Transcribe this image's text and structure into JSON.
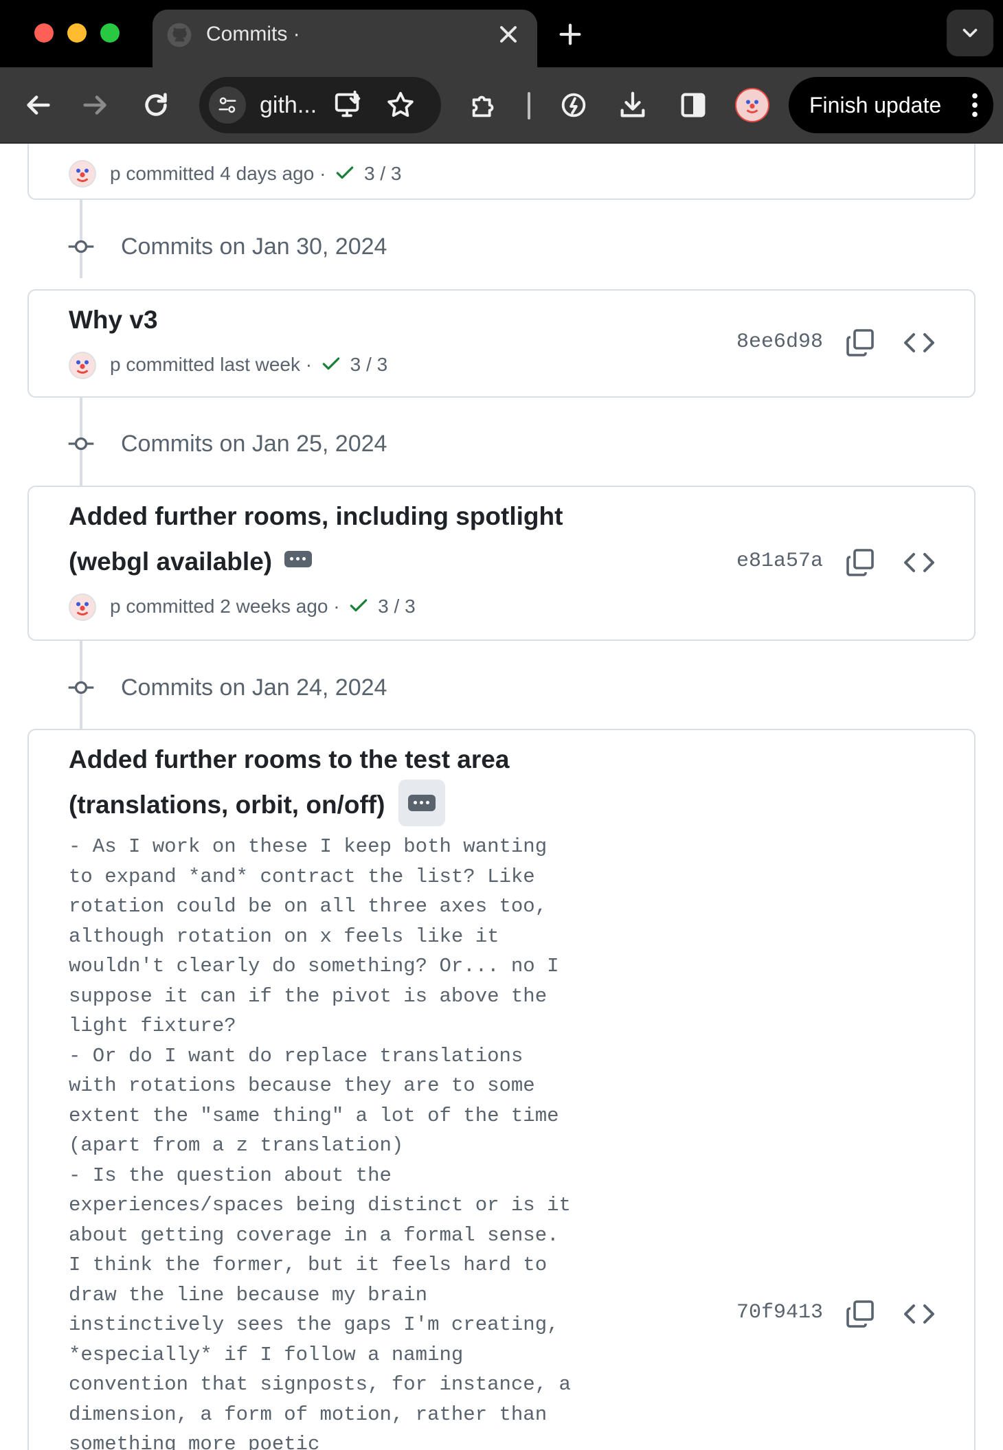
{
  "browser": {
    "tab_title": "Commits ·",
    "url_display": "gith...",
    "finish_update_label": "Finish update"
  },
  "commits": [
    {
      "author": "p",
      "time": "committed 4 days ago",
      "checks": "3 / 3"
    },
    {
      "date_header": "Commits on Jan 30, 2024",
      "title": "Why v3",
      "author": "p",
      "time": "committed last week",
      "checks": "3 / 3",
      "sha": "8ee6d98"
    },
    {
      "date_header": "Commits on Jan 25, 2024",
      "title_line1": "Added further rooms, including spotlight",
      "title_line2": "(webgl available)",
      "author": "p",
      "time": "committed 2 weeks ago",
      "checks": "3 / 3",
      "sha": "e81a57a"
    },
    {
      "date_header": "Commits on Jan 24, 2024",
      "title_line1": "Added further rooms to the test area",
      "title_line2": "(translations, orbit, on/off)",
      "description": "- As I work on these I keep both wanting\nto expand *and* contract the list? Like\nrotation could be on all three axes too,\nalthough rotation on x feels like it\nwouldn't clearly do something? Or... no I\nsuppose it can if the pivot is above the\nlight fixture?\n- Or do I want do replace translations\nwith rotations because they are to some\nextent the \"same thing\" a lot of the time\n(apart from a z translation)\n- Is the question about the\nexperiences/spaces being distinct or is it\nabout getting coverage in a formal sense.\nI think the former, but it feels hard to\ndraw the line because my brain\ninstinctively sees the gaps I'm creating,\n*especially* if I follow a naming\nconvention that signposts, for instance, a\ndimension, a form of motion, rather than\nsomething more poetic",
      "sha": "70f9413"
    }
  ],
  "colors": {
    "success_check": "#1a7f37",
    "border": "#d8dee4",
    "muted_text": "#59636e"
  }
}
